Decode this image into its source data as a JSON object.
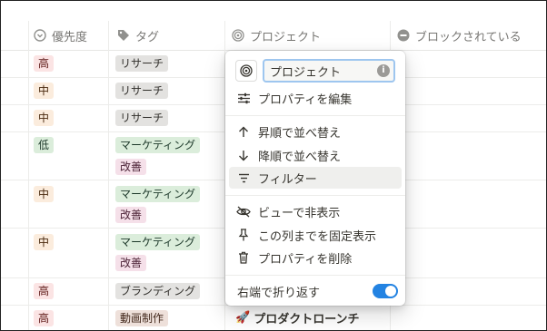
{
  "header": {
    "columns": [
      {
        "label": "優先度",
        "icon": "circle-chevron-icon"
      },
      {
        "label": "タグ",
        "icon": "tag-icon"
      },
      {
        "label": "プロジェクト",
        "icon": "target-icon"
      },
      {
        "label": "ブロックされている",
        "icon": "blocked-icon"
      }
    ]
  },
  "rows": [
    {
      "priority": "高",
      "tags": [
        "リサーチ"
      ]
    },
    {
      "priority": "中",
      "tags": [
        "リサーチ"
      ]
    },
    {
      "priority": "中",
      "tags": [
        "リサーチ"
      ]
    },
    {
      "priority": "低",
      "tags": [
        "マーケティング",
        "改善"
      ]
    },
    {
      "priority": "中",
      "tags": [
        "マーケティング",
        "改善"
      ]
    },
    {
      "priority": "中",
      "tags": [
        "マーケティング",
        "改善"
      ]
    },
    {
      "priority": "高",
      "tags": [
        "ブランディング"
      ]
    },
    {
      "priority": "高",
      "tags": [
        "動画制作"
      ],
      "project": "プロダクトローンチ",
      "project_icon": "rocket-icon"
    }
  ],
  "menu": {
    "name_input_value": "プロジェクト",
    "edit_property": "プロパティを編集",
    "sort_asc": "昇順で並べ替え",
    "sort_desc": "降順で並べ替え",
    "filter": "フィルター",
    "hide_in_view": "ビューで非表示",
    "freeze_up_to_column": "この列までを固定表示",
    "delete_property": "プロパティを削除",
    "wrap_label": "右端で折り返す",
    "wrap_enabled": true
  },
  "colors": {
    "accent": "#2383e2",
    "priority_high": "#fbe4e4",
    "priority_mid": "#fbecdd",
    "priority_low": "#dbeddb"
  }
}
